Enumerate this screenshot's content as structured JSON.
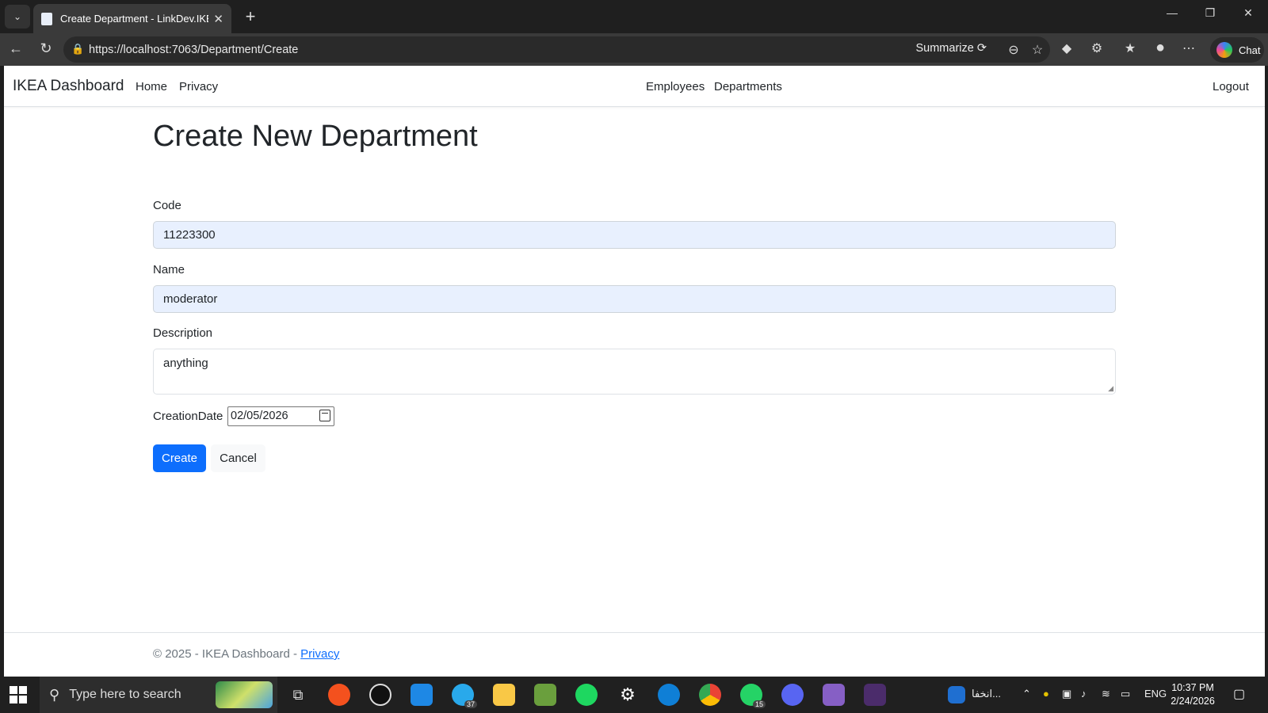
{
  "browser": {
    "tab_title": "Create Department - LinkDev.IKEA",
    "url": "https://localhost:7063/Department/Create",
    "summarize_label": "Summarize",
    "chat_label": "Chat"
  },
  "app": {
    "brand": "IKEA Dashboard",
    "nav_left": [
      "Home",
      "Privacy"
    ],
    "nav_center": [
      "Employees",
      "Departments"
    ],
    "logout": "Logout"
  },
  "form": {
    "heading": "Create New Department",
    "code_label": "Code",
    "code_value": "11223300",
    "name_label": "Name",
    "name_value": "moderator",
    "description_label": "Description",
    "description_value": "anything",
    "creation_date_label": "CreationDate",
    "creation_date_value": "02/05/2026",
    "create_button": "Create",
    "cancel_button": "Cancel"
  },
  "footer": {
    "text": "© 2025 - IKEA Dashboard - ",
    "privacy_link": "Privacy"
  },
  "taskbar": {
    "search_placeholder": "Type here to search",
    "notification_app_text": "انخفا...",
    "language": "ENG",
    "time": "10:37 PM",
    "date": "2/24/2026",
    "telegram_badge": "37",
    "whatsapp_badge": "15"
  },
  "colors": {
    "primary": "#0d6efd",
    "autofill_bg": "#e8f0fe"
  }
}
